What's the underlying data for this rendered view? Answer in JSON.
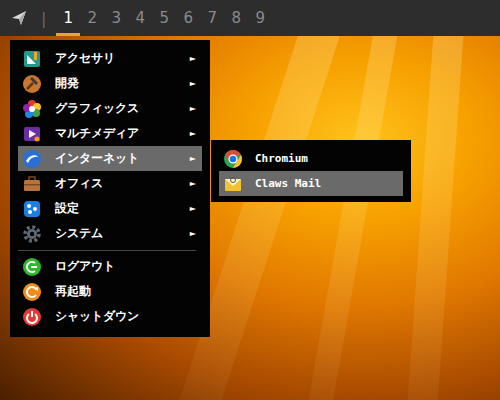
{
  "taskbar": {
    "separator": "|",
    "workspaces": [
      {
        "label": "1",
        "selected": true
      },
      {
        "label": "2",
        "selected": false
      },
      {
        "label": "3",
        "selected": false
      },
      {
        "label": "4",
        "selected": false
      },
      {
        "label": "5",
        "selected": false
      },
      {
        "label": "6",
        "selected": false
      },
      {
        "label": "7",
        "selected": false
      },
      {
        "label": "8",
        "selected": false
      },
      {
        "label": "9",
        "selected": false
      }
    ]
  },
  "menu": {
    "items": [
      {
        "label": "アクセサリ",
        "arrow": "►",
        "selected": false
      },
      {
        "label": "開発",
        "arrow": "►",
        "selected": false
      },
      {
        "label": "グラフィックス",
        "arrow": "►",
        "selected": false
      },
      {
        "label": "マルチメディア",
        "arrow": "►",
        "selected": false
      },
      {
        "label": "インターネット",
        "arrow": "►",
        "selected": true
      },
      {
        "label": "オフィス",
        "arrow": "►",
        "selected": false
      },
      {
        "label": "設定",
        "arrow": "►",
        "selected": false
      },
      {
        "label": "システム",
        "arrow": "►",
        "selected": false
      }
    ],
    "session_items": [
      {
        "label": "ログアウト",
        "selected": false
      },
      {
        "label": "再起動",
        "selected": false
      },
      {
        "label": "シャットダウン",
        "selected": false
      }
    ]
  },
  "submenu": {
    "items": [
      {
        "label": "Chromium",
        "selected": false
      },
      {
        "label": "Claws Mail",
        "selected": true
      }
    ]
  }
}
